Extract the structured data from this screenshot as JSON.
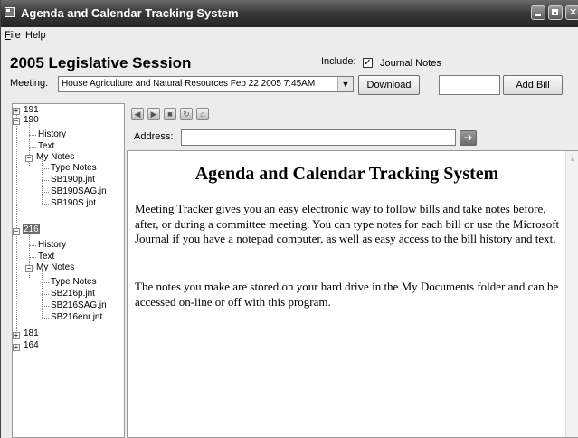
{
  "window": {
    "title": "Agenda and Calendar Tracking System"
  },
  "menu": {
    "file_underline": "F",
    "file_rest": "ile",
    "help": "Help"
  },
  "header": {
    "session_title": "2005 Legislative Session",
    "include_label": "Include:",
    "journal_notes_label": "Journal Notes",
    "journal_notes_checked": true,
    "meeting_label": "Meeting:",
    "meeting_value": "House Agriculture and Natural Resources Feb 22 2005  7:45AM",
    "download_label": "Download",
    "bill_input_value": "",
    "add_bill_label": "Add Bill"
  },
  "tree": {
    "n191": "191",
    "n190": "190",
    "n190_history": "History",
    "n190_text": "Text",
    "n190_mynotes": "My Notes",
    "n190_typenotes": "Type Notes",
    "n190_f1": "SB190p.jnt",
    "n190_f2": "SB190SAG.jn",
    "n190_f3": "SB190S.jnt",
    "n216": "216",
    "n216_history": "History",
    "n216_text": "Text",
    "n216_mynotes": "My Notes",
    "n216_typenotes": "Type Notes",
    "n216_f1": "SB216p.jnt",
    "n216_f2": "SB216SAG.jn",
    "n216_f3": "SB216enr.jnt",
    "n181": "181",
    "n164": "164"
  },
  "browser": {
    "address_label": "Address:",
    "address_value": ""
  },
  "content": {
    "heading": "Agenda and Calendar Tracking System",
    "paragraph1": "Meeting Tracker gives you an easy electronic way to follow bills and take notes before, after, or during a committee meeting. You can type notes for each bill or use the Microsoft Journal if you have a notepad computer, as well as easy access to the bill history and text.",
    "paragraph2": "The notes you make are stored on your hard drive in the My Documents folder and can be accessed on-line or off with this program."
  },
  "icons": {
    "app": "app-window-icon",
    "back": "back-icon",
    "forward": "forward-icon",
    "stop": "stop-icon",
    "refresh": "refresh-icon",
    "home": "home-icon",
    "go": "go-arrow-icon"
  }
}
